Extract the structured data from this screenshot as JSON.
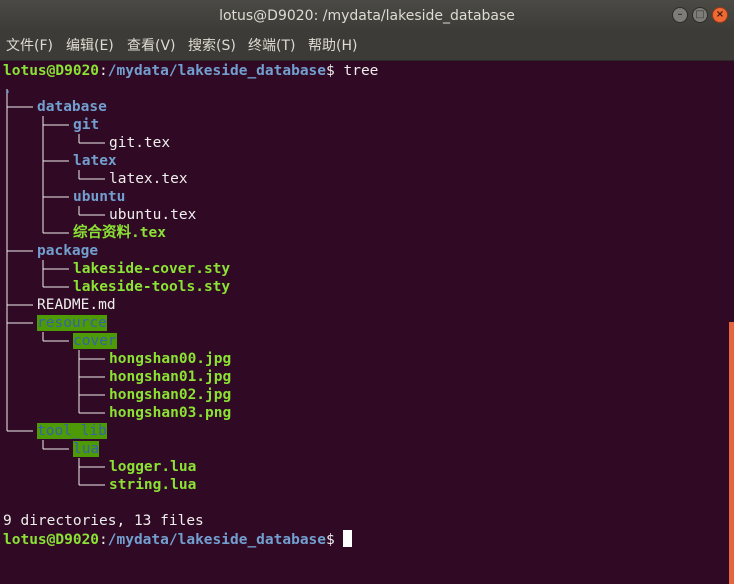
{
  "window": {
    "title": "lotus@D9020: /mydata/lakeside_database",
    "buttons": {
      "minimize": "–",
      "maximize": "□",
      "close": "×"
    }
  },
  "menu": [
    "文件(F)",
    "编辑(E)",
    "查看(V)",
    "搜索(S)",
    "终端(T)",
    "帮助(H)"
  ],
  "terminal": {
    "prompt_user": "lotus@D9020",
    "prompt_sep": ":",
    "prompt_path": "/mydata/lakeside_database",
    "prompt_symbol": "$",
    "command": " tree",
    "tree": [
      {
        "name": ".",
        "style": "dir"
      },
      {
        "name": "database",
        "style": "dir"
      },
      {
        "name": "git",
        "style": "dir"
      },
      {
        "name": "git.tex",
        "style": "file"
      },
      {
        "name": "latex",
        "style": "dir"
      },
      {
        "name": "latex.tex",
        "style": "file"
      },
      {
        "name": "ubuntu",
        "style": "dir"
      },
      {
        "name": "ubuntu.tex",
        "style": "file"
      },
      {
        "name": "综合资料.tex",
        "style": "green"
      },
      {
        "name": "package",
        "style": "dir"
      },
      {
        "name": "lakeside-cover.sty",
        "style": "green"
      },
      {
        "name": "lakeside-tools.sty",
        "style": "green"
      },
      {
        "name": "README.md",
        "style": "file"
      },
      {
        "name": "resource",
        "style": "hl"
      },
      {
        "name": "cover",
        "style": "hl"
      },
      {
        "name": "hongshan00.jpg",
        "style": "green"
      },
      {
        "name": "hongshan01.jpg",
        "style": "green"
      },
      {
        "name": "hongshan02.jpg",
        "style": "green"
      },
      {
        "name": "hongshan03.png",
        "style": "green"
      },
      {
        "name": "tool_lib",
        "style": "hl"
      },
      {
        "name": "lua",
        "style": "hl"
      },
      {
        "name": "logger.lua",
        "style": "green"
      },
      {
        "name": "string.lua",
        "style": "green"
      }
    ],
    "summary": "9 directories, 13 files"
  }
}
